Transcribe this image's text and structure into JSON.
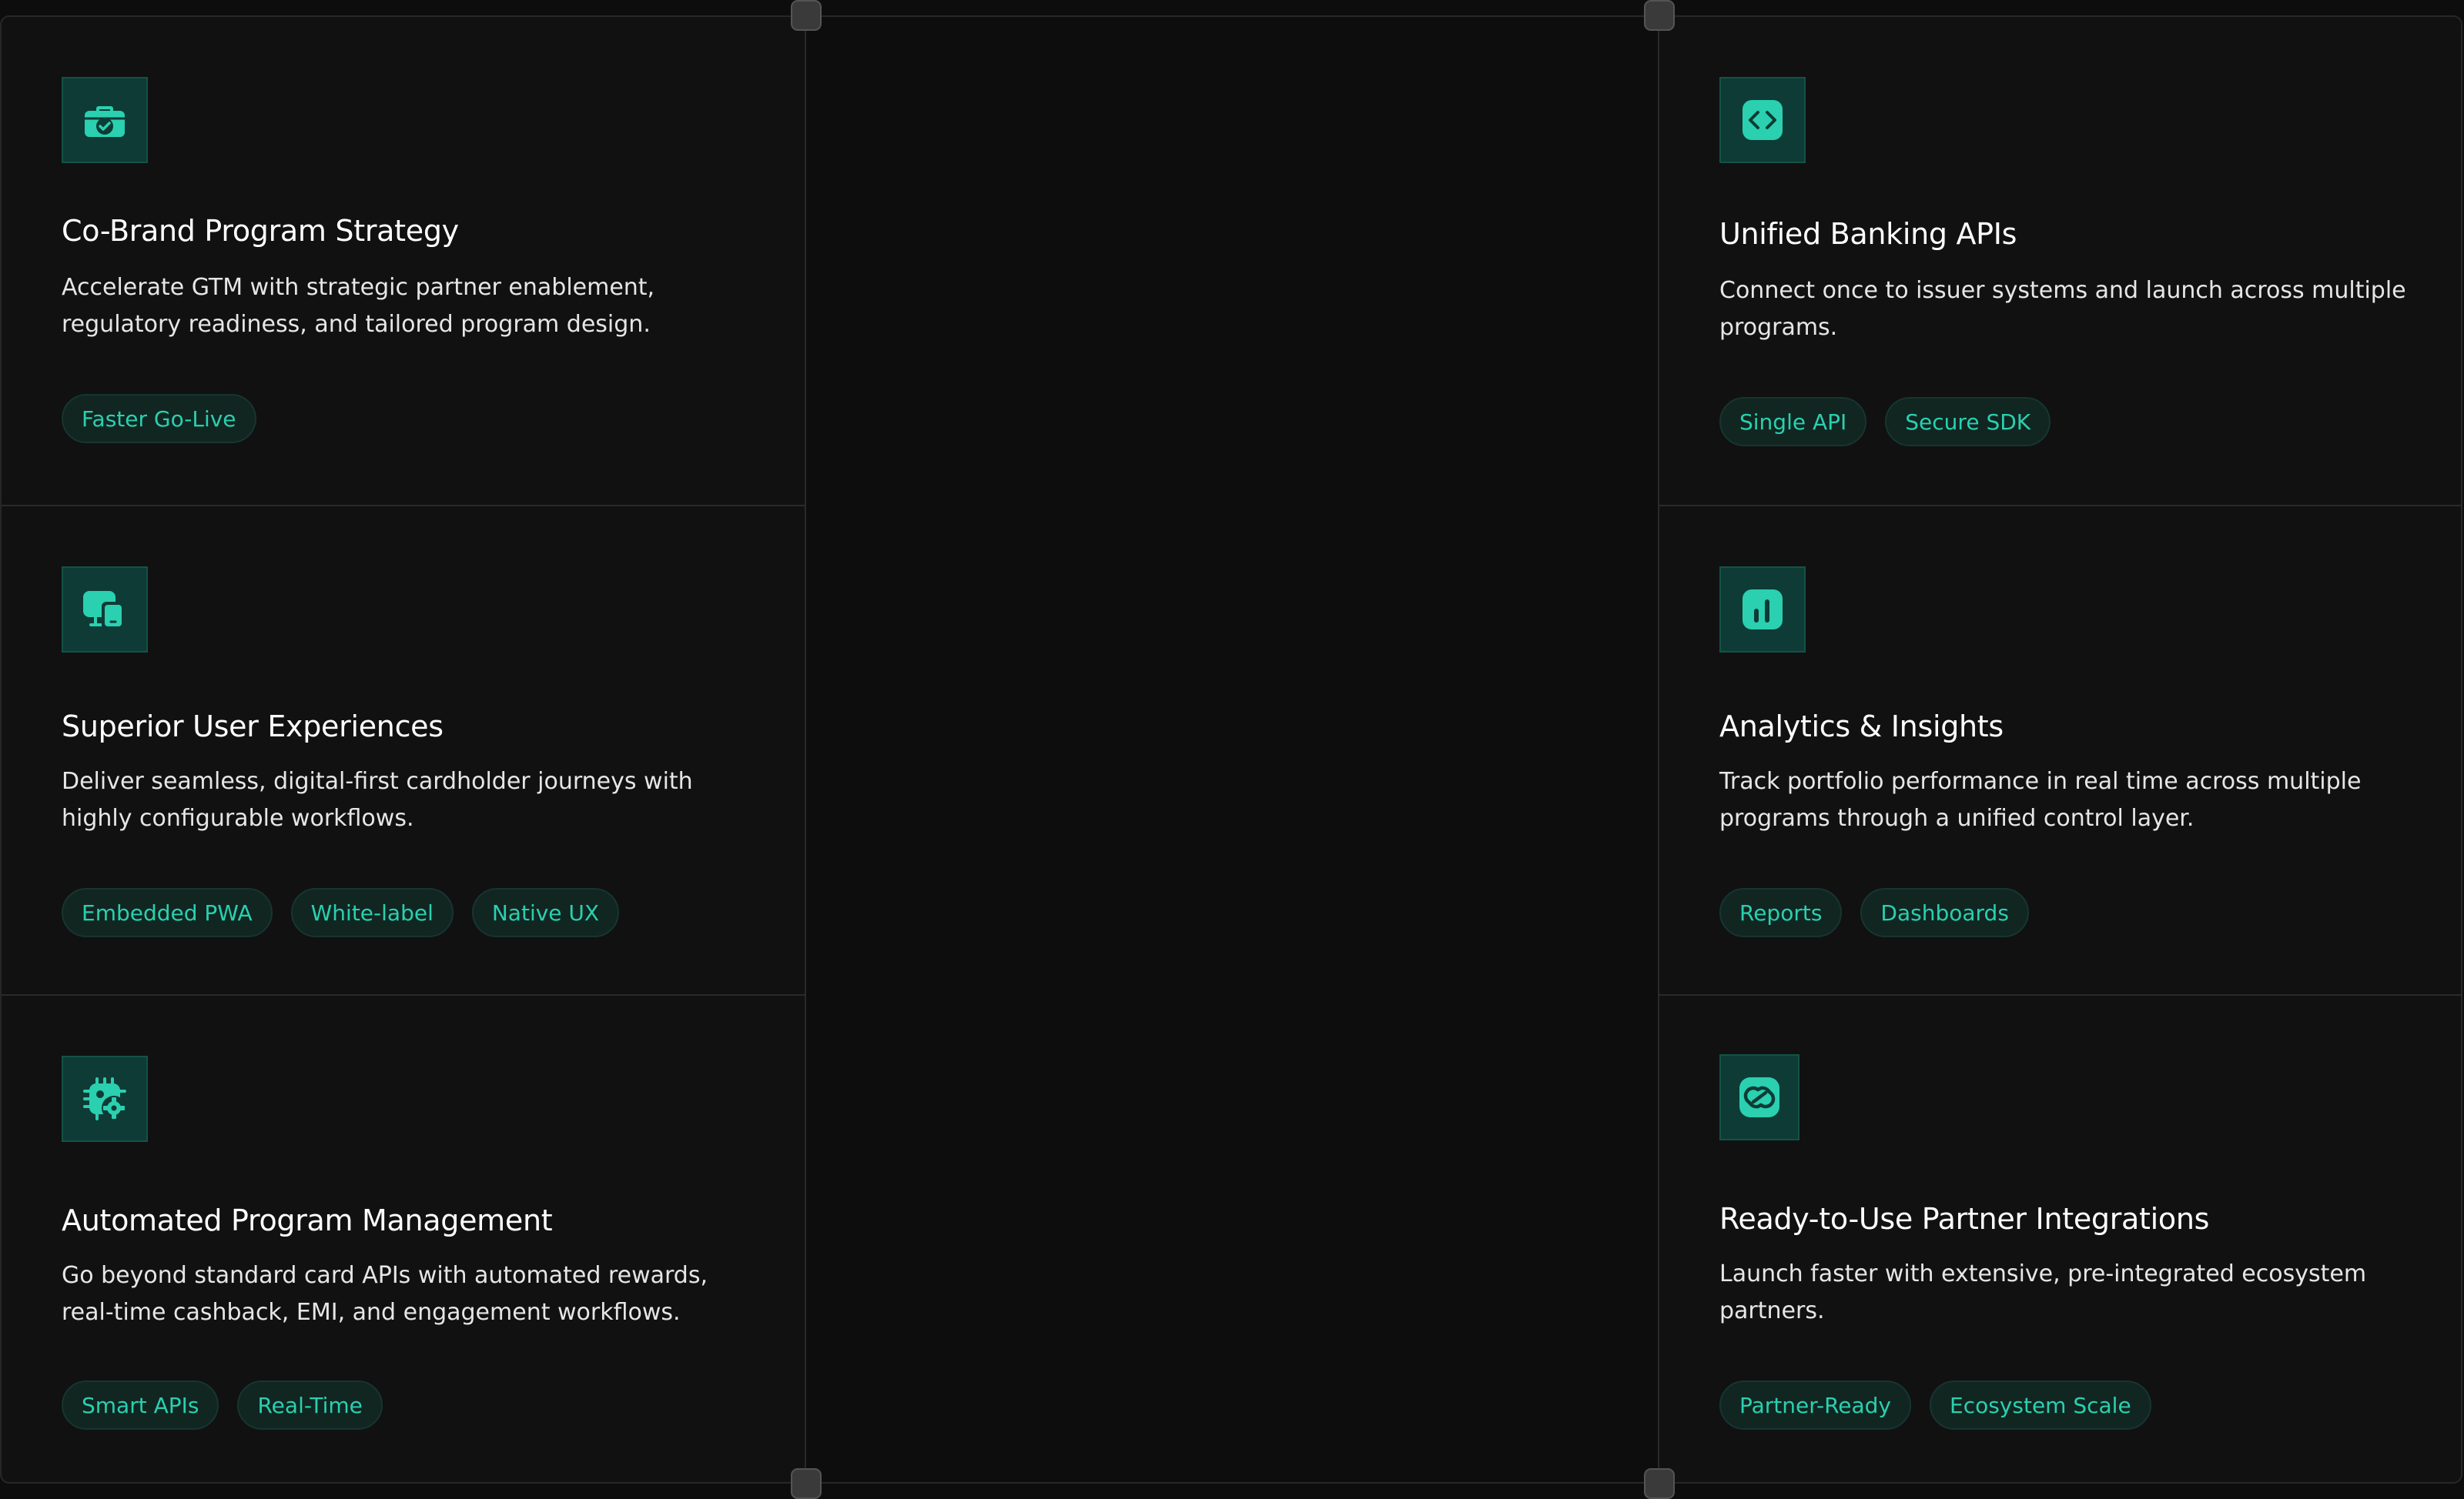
{
  "colors": {
    "accent": "#2ad0b0",
    "icon_bg": "#0e3b35",
    "card_bg": "#111111",
    "page_bg": "#0d0d0d",
    "tag_bg": "#112621",
    "border": "#2a2a2a"
  },
  "cards": [
    {
      "icon": "briefcase-check-icon",
      "title": "Co-Brand Program Strategy",
      "description": "Accelerate GTM with strategic partner enablement, regulatory readiness, and tailored program design.",
      "tags": [
        "Faster Go-Live"
      ]
    },
    {
      "icon": "code-brackets-icon",
      "title": "Unified Banking APIs",
      "description": "Connect once to issuer systems and launch across multiple programs.",
      "tags": [
        "Single API",
        "Secure SDK"
      ]
    },
    {
      "icon": "devices-icon",
      "title": "Superior User Experiences",
      "description": "Deliver seamless, digital-first cardholder journeys with highly configurable workflows.",
      "tags": [
        "Embedded PWA",
        "White-label",
        "Native UX"
      ]
    },
    {
      "icon": "bar-chart-icon",
      "title": "Analytics & Insights",
      "description": "Track portfolio performance in real time across multiple programs through a unified control layer.",
      "tags": [
        "Reports",
        "Dashboards"
      ]
    },
    {
      "icon": "chip-gear-icon",
      "title": "Automated Program Management",
      "description": "Go beyond standard card APIs with automated rewards, real-time cashback, EMI, and engagement workflows.",
      "tags": [
        "Smart APIs",
        "Real-Time"
      ]
    },
    {
      "icon": "link-icon",
      "title": "Ready-to-Use Partner Integrations",
      "description": "Launch faster with extensive, pre-integrated ecosystem partners.",
      "tags": [
        "Partner-Ready",
        "Ecosystem Scale"
      ]
    }
  ]
}
